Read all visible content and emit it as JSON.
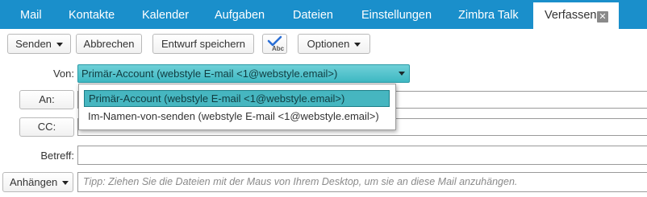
{
  "tabs": [
    {
      "label": "Mail"
    },
    {
      "label": "Kontakte"
    },
    {
      "label": "Kalender"
    },
    {
      "label": "Aufgaben"
    },
    {
      "label": "Dateien"
    },
    {
      "label": "Einstellungen"
    },
    {
      "label": "Zimbra Talk"
    },
    {
      "label": "Verfassen",
      "active": true,
      "close_icon": "close-icon"
    }
  ],
  "toolbar": {
    "send_label": "Senden",
    "cancel_label": "Abbrechen",
    "save_draft_label": "Entwurf speichern",
    "spellcheck_icon": "spellcheck-icon",
    "options_label": "Optionen"
  },
  "form": {
    "from_label": "Von:",
    "from_value": "Primär-Account (webstyle E-mail <1@webstyle.email>)",
    "from_options": [
      "Primär-Account (webstyle E-mail <1@webstyle.email>)",
      "Im-Namen-von-senden (webstyle E-mail <1@webstyle.email>)"
    ],
    "to_button": "An:",
    "cc_button": "CC:",
    "subject_label": "Betreff:",
    "attach_label": "Anhängen",
    "attach_hint": "Tipp: Ziehen Sie die Dateien mit der Maus von Ihrem Desktop, um sie an diese Mail anzuhängen."
  },
  "colors": {
    "tabbar": "#1a8fcb",
    "selection": "#46b6c0"
  }
}
